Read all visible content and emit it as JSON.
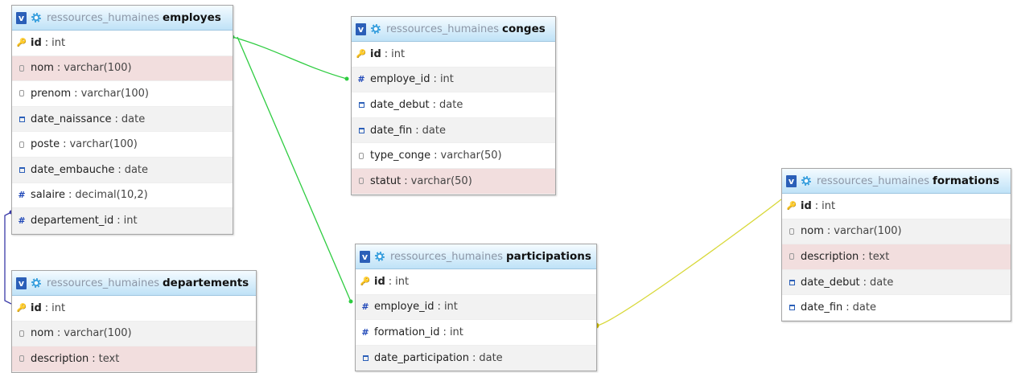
{
  "database": "ressources_humaines",
  "colors": {
    "employes_conges": "#2ecc40",
    "employes_participations": "#2ecc40",
    "employes_departements": "#3a3aa8",
    "participations_formations": "#d8d838"
  },
  "tables": {
    "employes": {
      "name": "employes",
      "columns": [
        {
          "name": "id",
          "type": "int",
          "icon": "key-icon",
          "pk": true
        },
        {
          "name": "nom",
          "type": "varchar(100)",
          "icon": "text-field-icon"
        },
        {
          "name": "prenom",
          "type": "varchar(100)",
          "icon": "text-field-icon"
        },
        {
          "name": "date_naissance",
          "type": "date",
          "icon": "calendar-icon"
        },
        {
          "name": "poste",
          "type": "varchar(100)",
          "icon": "text-field-icon"
        },
        {
          "name": "date_embauche",
          "type": "date",
          "icon": "calendar-icon"
        },
        {
          "name": "salaire",
          "type": "decimal(10,2)",
          "icon": "number-icon"
        },
        {
          "name": "departement_id",
          "type": "int",
          "icon": "number-icon"
        }
      ]
    },
    "conges": {
      "name": "conges",
      "columns": [
        {
          "name": "id",
          "type": "int",
          "icon": "key-icon",
          "pk": true
        },
        {
          "name": "employe_id",
          "type": "int",
          "icon": "number-icon"
        },
        {
          "name": "date_debut",
          "type": "date",
          "icon": "calendar-icon"
        },
        {
          "name": "date_fin",
          "type": "date",
          "icon": "calendar-icon"
        },
        {
          "name": "type_conge",
          "type": "varchar(50)",
          "icon": "text-field-icon"
        },
        {
          "name": "statut",
          "type": "varchar(50)",
          "icon": "text-field-icon"
        }
      ]
    },
    "departements": {
      "name": "departements",
      "columns": [
        {
          "name": "id",
          "type": "int",
          "icon": "key-icon",
          "pk": true
        },
        {
          "name": "nom",
          "type": "varchar(100)",
          "icon": "text-field-icon"
        },
        {
          "name": "description",
          "type": "text",
          "icon": "text-field-icon"
        }
      ]
    },
    "participations": {
      "name": "participations",
      "columns": [
        {
          "name": "id",
          "type": "int",
          "icon": "key-icon",
          "pk": true
        },
        {
          "name": "employe_id",
          "type": "int",
          "icon": "number-icon"
        },
        {
          "name": "formation_id",
          "type": "int",
          "icon": "number-icon"
        },
        {
          "name": "date_participation",
          "type": "date",
          "icon": "calendar-icon"
        }
      ]
    },
    "formations": {
      "name": "formations",
      "columns": [
        {
          "name": "id",
          "type": "int",
          "icon": "key-icon",
          "pk": true
        },
        {
          "name": "nom",
          "type": "varchar(100)",
          "icon": "text-field-icon"
        },
        {
          "name": "description",
          "type": "text",
          "icon": "text-field-icon"
        },
        {
          "name": "date_debut",
          "type": "date",
          "icon": "calendar-icon"
        },
        {
          "name": "date_fin",
          "type": "date",
          "icon": "calendar-icon"
        }
      ]
    }
  }
}
